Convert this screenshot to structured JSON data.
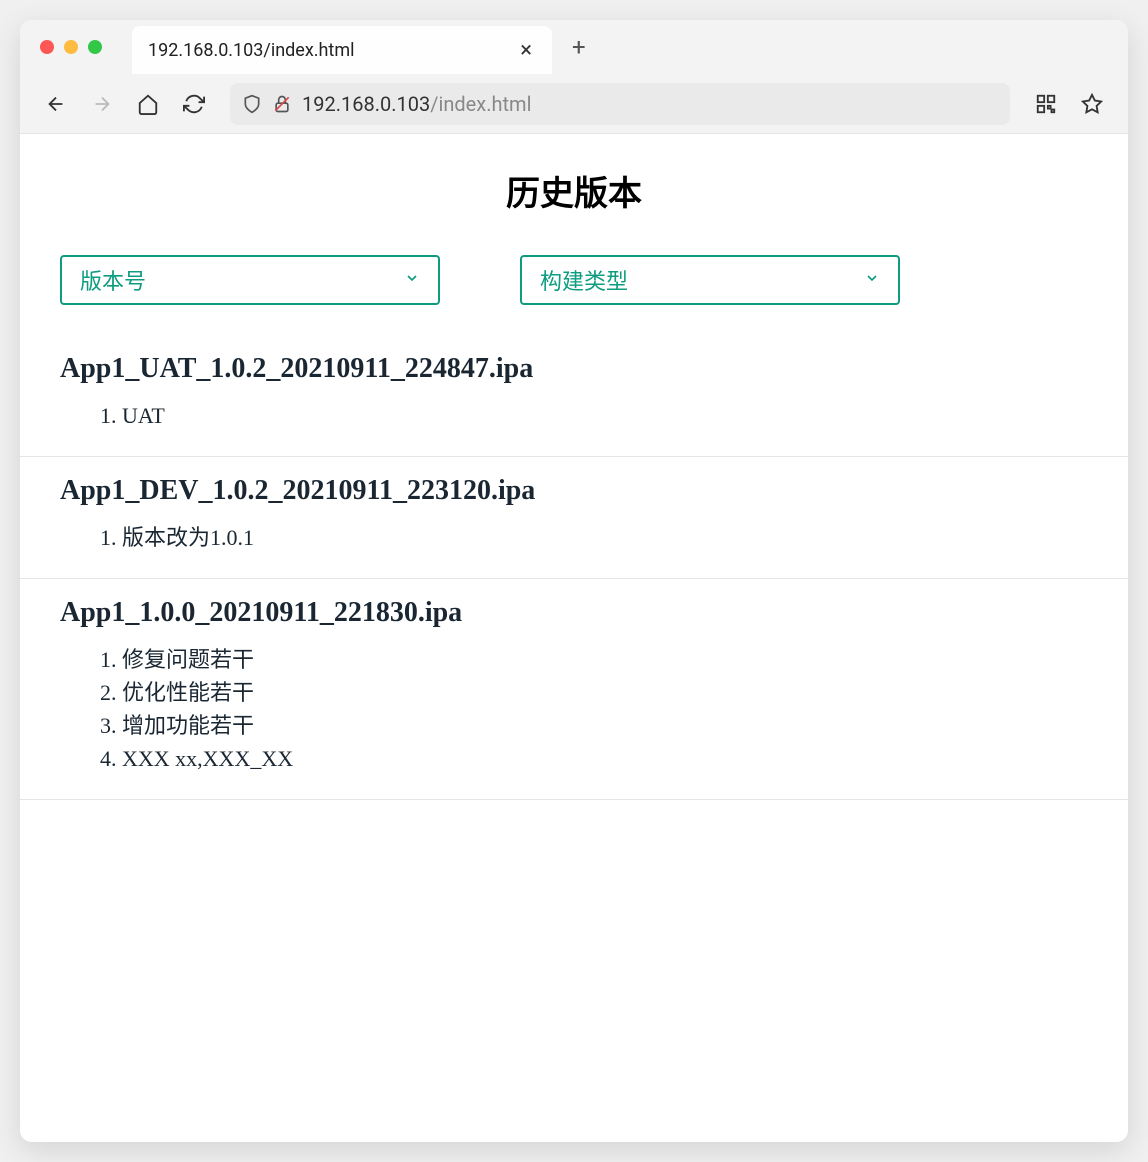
{
  "browser": {
    "tab_title": "192.168.0.103/index.html",
    "url_host": "192.168.0.103",
    "url_path": "/index.html"
  },
  "page": {
    "title": "历史版本",
    "filters": {
      "version": "版本号",
      "build_type": "构建类型"
    },
    "versions": [
      {
        "name": "App1_UAT_1.0.2_20210911_224847.ipa",
        "notes": [
          "UAT"
        ]
      },
      {
        "name": "App1_DEV_1.0.2_20210911_223120.ipa",
        "notes": [
          "版本改为1.0.1"
        ]
      },
      {
        "name": "App1_1.0.0_20210911_221830.ipa",
        "notes": [
          "修复问题若干",
          "优化性能若干",
          "增加功能若干",
          "XXX xx,XXX_XX"
        ]
      }
    ]
  }
}
